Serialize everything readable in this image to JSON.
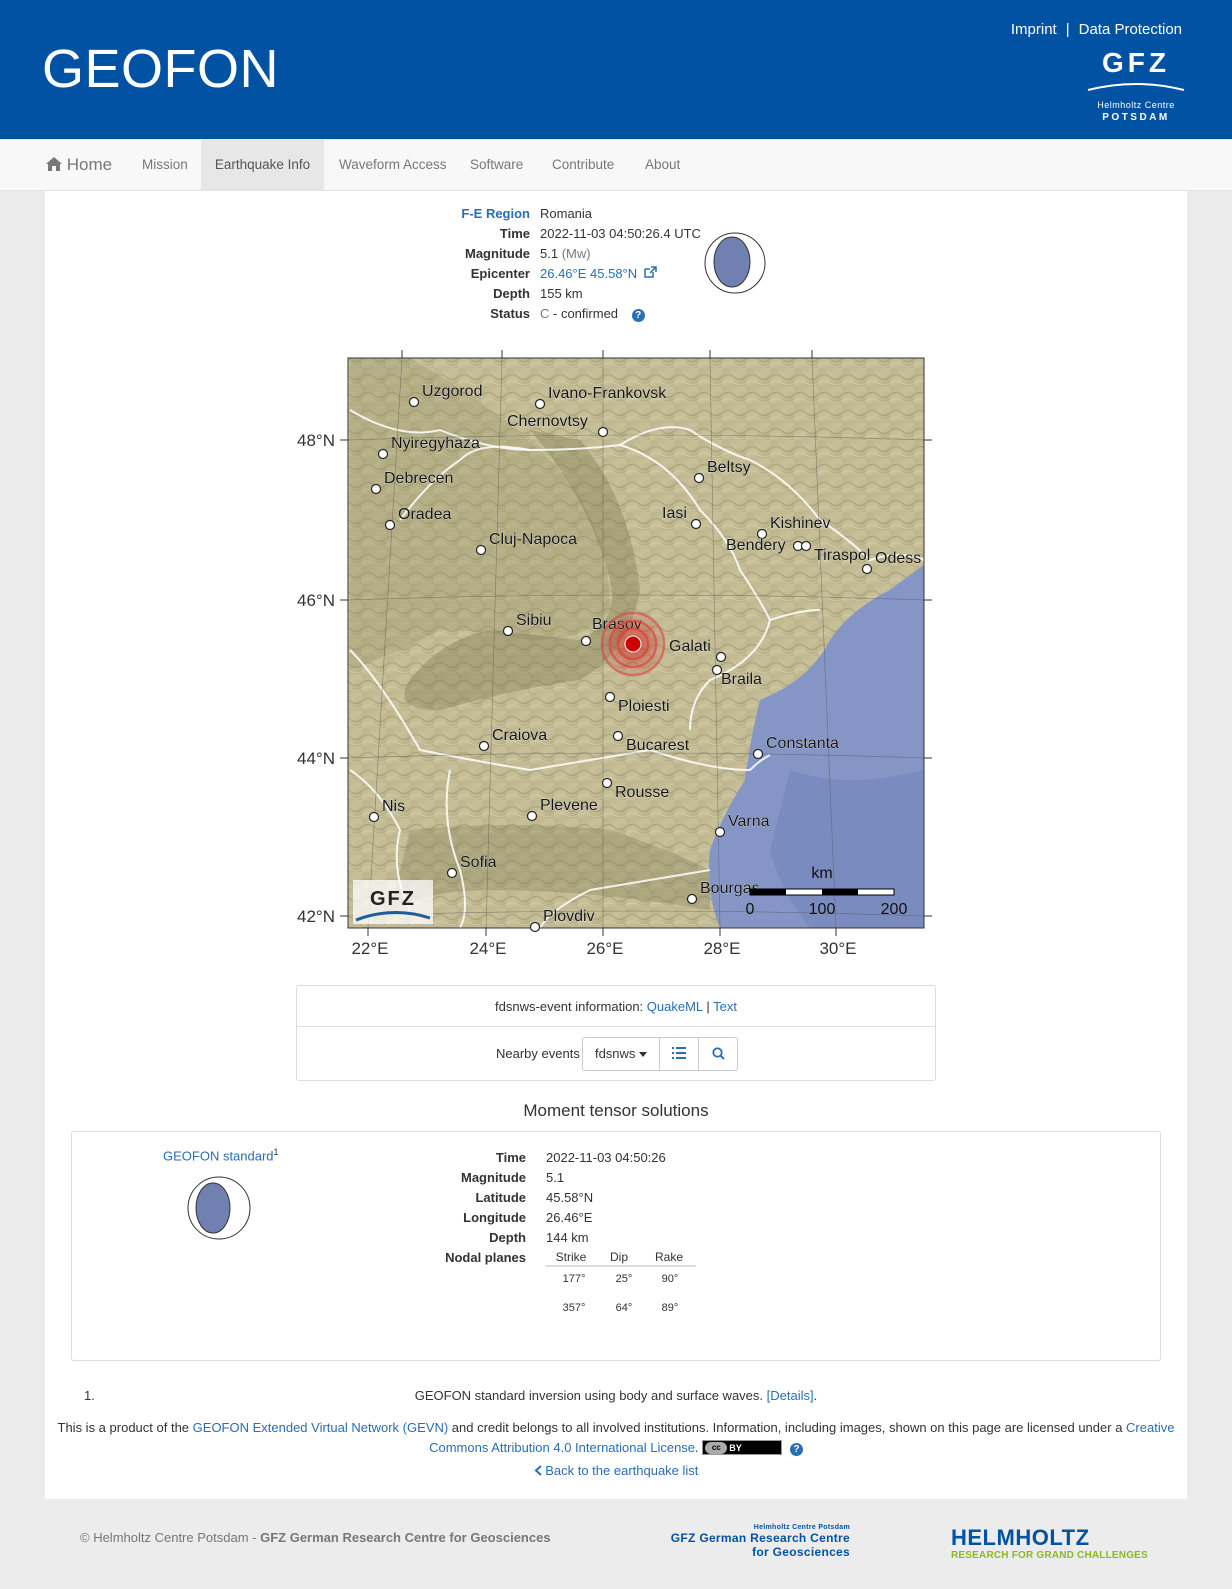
{
  "header": {
    "brand": "GEOFON",
    "links": [
      "Imprint",
      "Data Protection"
    ],
    "separator": "|",
    "logo": {
      "text": "GFZ",
      "line1": "Helmholtz Centre",
      "line2": "POTSDAM"
    }
  },
  "nav": {
    "home": "Home",
    "items": [
      "Mission",
      "Earthquake Info",
      "Waveform Access",
      "Software",
      "Contribute",
      "About"
    ],
    "active": "Earthquake Info"
  },
  "event": {
    "labels": {
      "region": "F-E Region",
      "time": "Time",
      "magnitude": "Magnitude",
      "epicenter": "Epicenter",
      "depth": "Depth",
      "status": "Status"
    },
    "region": "Romania",
    "time": "2022-11-03 04:50:26.4 UTC",
    "magnitude": "5.1",
    "magnitude_type": "(Mw)",
    "epicenter": "26.46°E 45.58°N",
    "depth": "155 km",
    "status_code": "C",
    "status_text": "- confirmed"
  },
  "map": {
    "lat_labels": [
      "48°N",
      "46°N",
      "44°N",
      "42°N"
    ],
    "lon_labels": [
      "22°E",
      "24°E",
      "26°E",
      "28°E",
      "30°E"
    ],
    "cities": [
      {
        "name": "Uzgorod"
      },
      {
        "name": "Ivano-Frankovsk"
      },
      {
        "name": "Chernovtsy"
      },
      {
        "name": "Nyiregyhaza"
      },
      {
        "name": "Debrecen"
      },
      {
        "name": "Oradea"
      },
      {
        "name": "Cluj-Napoca"
      },
      {
        "name": "Beltsy"
      },
      {
        "name": "Iasi"
      },
      {
        "name": "Kishinev"
      },
      {
        "name": "Bendery"
      },
      {
        "name": "Tiraspol"
      },
      {
        "name": "Odess"
      },
      {
        "name": "Sibiu"
      },
      {
        "name": "Brasov"
      },
      {
        "name": "Galati"
      },
      {
        "name": "Braila"
      },
      {
        "name": "Ploiesti"
      },
      {
        "name": "Craiova"
      },
      {
        "name": "Bucarest"
      },
      {
        "name": "Constanta"
      },
      {
        "name": "Nis"
      },
      {
        "name": "Plevene"
      },
      {
        "name": "Rousse"
      },
      {
        "name": "Varna"
      },
      {
        "name": "Sofia"
      },
      {
        "name": "Bourgas"
      },
      {
        "name": "Plovdiv"
      }
    ],
    "scale_unit": "km",
    "scale_labels": [
      "0",
      "100",
      "200"
    ],
    "logo": "GFZ"
  },
  "fdsn": {
    "label": "fdsnws-event information:",
    "quakeml": "QuakeML",
    "sep": "|",
    "text": "Text",
    "nearby_label": "Nearby events",
    "dropdown": "fdsnws"
  },
  "moment_tensor": {
    "title": "Moment tensor solutions",
    "source": "GEOFON standard",
    "footnote_mark": "1",
    "labels": {
      "time": "Time",
      "magnitude": "Magnitude",
      "latitude": "Latitude",
      "longitude": "Longitude",
      "depth": "Depth",
      "nodal": "Nodal planes"
    },
    "time": "2022-11-03 04:50:26",
    "magnitude": "5.1",
    "latitude": "45.58°N",
    "longitude": "26.46°E",
    "depth": "144 km",
    "nodal_headers": [
      "Strike",
      "Dip",
      "Rake"
    ],
    "nodal_planes": [
      [
        "177°",
        "25°",
        "90°"
      ],
      [
        "357°",
        "64°",
        "89°"
      ]
    ]
  },
  "footnote": {
    "number": "1.",
    "text": "GEOFON standard inversion using body and surface waves.",
    "link": "[Details]",
    "end": "."
  },
  "credit": {
    "t1": "This is a product of the",
    "l1": "GEOFON Extended Virtual Network (GEVN)",
    "t2": "and credit belongs to all involved institutions. Information, including images, shown on this page are licensed under a",
    "l2": "Creative Commons Attribution 4.0 International License",
    "t3": ".",
    "badge_cc": "cc",
    "badge_by": "BY"
  },
  "back": "Back to the earthquake list",
  "footer": {
    "copy_prefix": "© Helmholtz Centre Potsdam -",
    "copy_bold": "GFZ German Research Centre for Geosciences",
    "gfz_small": "Helmholtz Centre Potsdam",
    "gfz_line1": "GFZ German Research Centre",
    "gfz_line2": "for Geosciences",
    "helm_1": "HELMHOLTZ",
    "helm_2": "RESEARCH FOR GRAND CHALLENGES"
  },
  "colors": {
    "header_blue": "#0152a3",
    "link": "#2a6eb4",
    "beachball": "#7080b0",
    "epicenter": "#cc0000",
    "helmholtz_green": "#8cb828"
  }
}
